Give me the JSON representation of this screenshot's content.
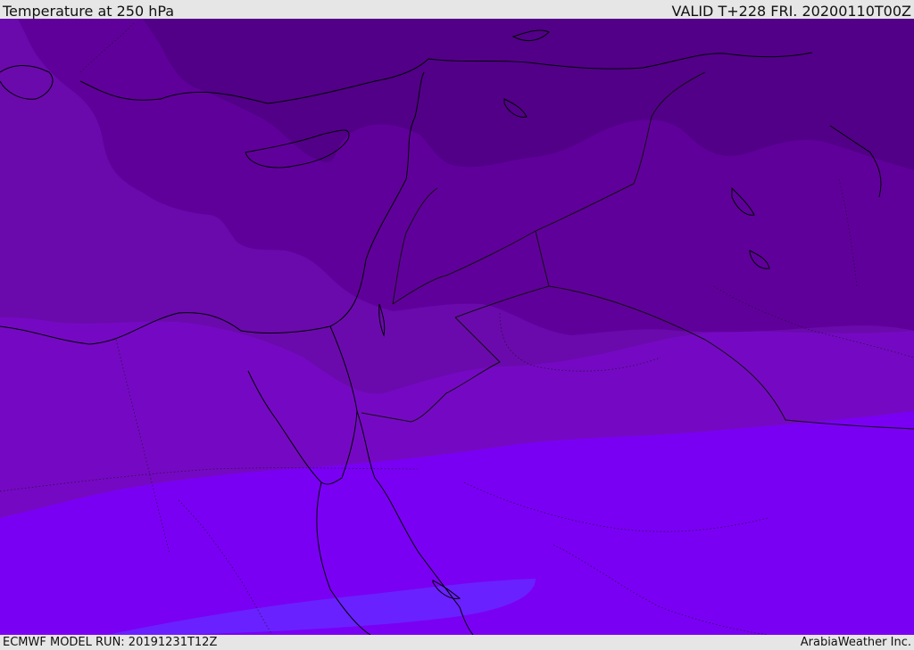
{
  "header": {
    "title": "Temperature at 250 hPa",
    "valid": "VALID T+228 FRI. 20200110T00Z"
  },
  "footer": {
    "model_run": "ECMWF MODEL RUN: 20191231T12Z",
    "credit": "ArabiaWeather Inc."
  },
  "colors": {
    "band_coldest": "#520088",
    "band_colder": "#60009b",
    "band_cold": "#6a0aac",
    "band_cool": "#7509c3",
    "band_mild": "#7a00f4",
    "band_warm": "#6a21ff",
    "coast": "#000000",
    "border": "#111111"
  }
}
